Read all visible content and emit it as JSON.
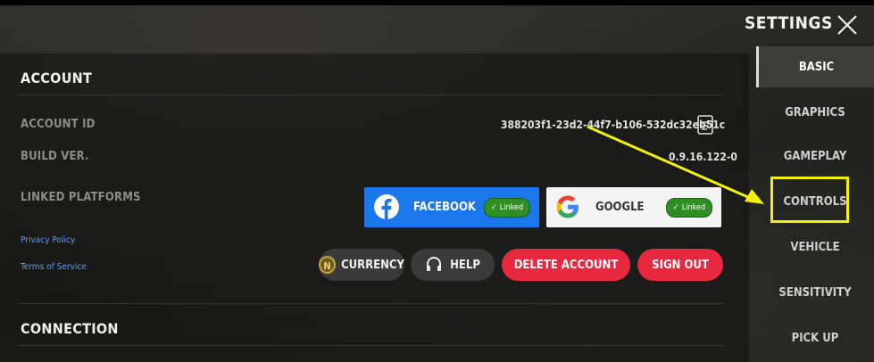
{
  "header": {
    "title": "SETTINGS",
    "close_icon": "close-icon"
  },
  "account": {
    "section_title": "ACCOUNT",
    "account_id_label": "ACCOUNT ID",
    "account_id_value": "388203f1-23d2-44f7-b106-532dc32eb51c",
    "build_label": "BUILD VER.",
    "build_value": "0.9.16.122-0",
    "linked_label": "LINKED PLATFORMS",
    "privacy_link": "Privacy Policy",
    "terms_link": "Terms of Service",
    "platforms": [
      {
        "name": "FACEBOOK",
        "status": "Linked",
        "color": "#1b77ec"
      },
      {
        "name": "GOOGLE",
        "status": "Linked",
        "color": "#f4f4f4"
      }
    ],
    "buttons": {
      "currency": "CURRENCY",
      "help": "HELP",
      "delete": "DELETE ACCOUNT",
      "signout": "SIGN OUT"
    }
  },
  "connection": {
    "section_title": "CONNECTION"
  },
  "sidebar": {
    "items": [
      {
        "label": "BASIC",
        "active": true
      },
      {
        "label": "GRAPHICS",
        "active": false
      },
      {
        "label": "GAMEPLAY",
        "active": false
      },
      {
        "label": "CONTROLS",
        "active": false
      },
      {
        "label": "VEHICLE",
        "active": false
      },
      {
        "label": "SENSITIVITY",
        "active": false
      },
      {
        "label": "PICK UP",
        "active": false
      }
    ]
  },
  "colors": {
    "accent_red": "#e8283f",
    "annotation_yellow": "#f4f20a",
    "linked_green": "#2f8f22"
  }
}
